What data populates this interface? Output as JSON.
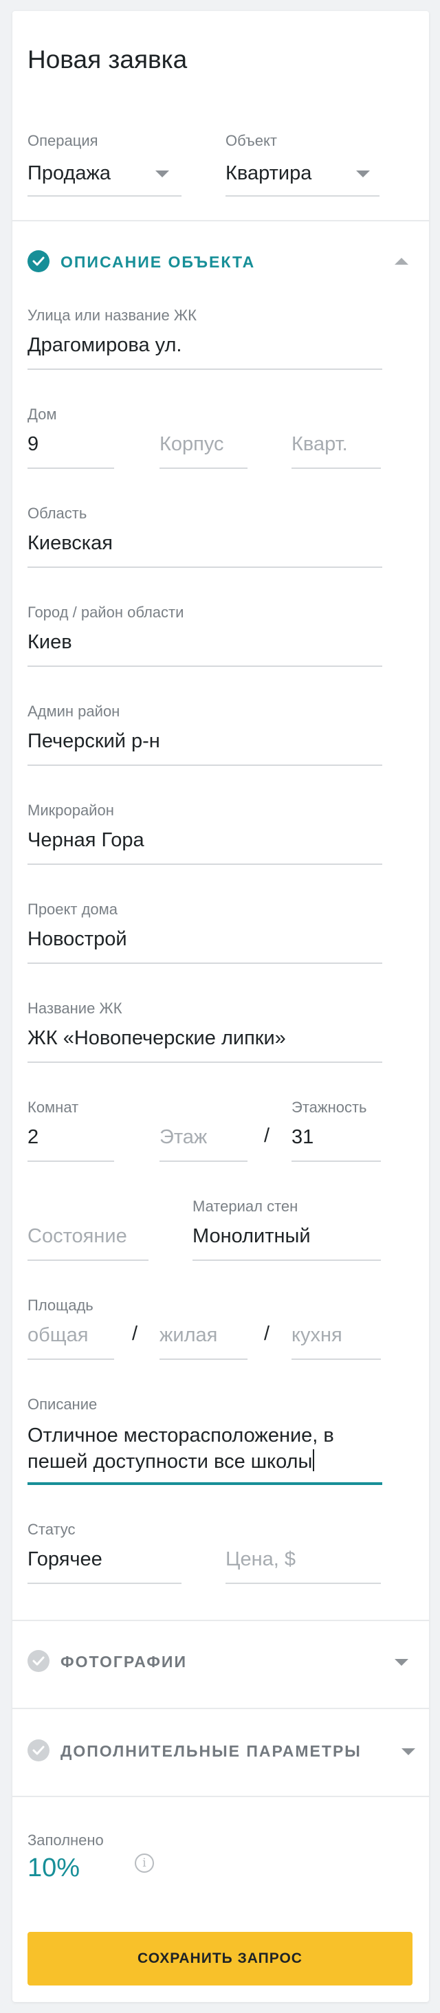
{
  "form": {
    "title": "Новая заявка",
    "operation": {
      "label": "Операция",
      "value": "Продажа"
    },
    "object": {
      "label": "Объект",
      "value": "Квартира"
    }
  },
  "sections": {
    "description": {
      "title": "ОПИСАНИЕ ОБЪЕКТА",
      "expanded": true
    },
    "photos": {
      "title": "ФОТОГРАФИИ",
      "expanded": false
    },
    "extra": {
      "title": "ДОПОЛНИТЕЛЬНЫЕ ПАРАМЕТРЫ",
      "expanded": false
    }
  },
  "fields": {
    "street": {
      "label": "Улица или название ЖК",
      "value": "Драгомирова ул."
    },
    "house": {
      "label": "Дом",
      "value": "9"
    },
    "building": {
      "placeholder": "Корпус"
    },
    "apartment": {
      "placeholder": "Кварт."
    },
    "region": {
      "label": "Область",
      "value": "Киевская"
    },
    "city": {
      "label": "Город / район области",
      "value": "Киев"
    },
    "admin_district": {
      "label": "Админ район",
      "value": "Печерский р-н"
    },
    "microdistrict": {
      "label": "Микрорайон",
      "value": "Черная Гора"
    },
    "house_project": {
      "label": "Проект дома",
      "value": "Новострой"
    },
    "complex_name": {
      "label": "Название ЖК",
      "value": "ЖК «Новопечерские липки»"
    },
    "rooms": {
      "label": "Комнат",
      "value": "2"
    },
    "floor": {
      "placeholder": "Этаж"
    },
    "floors_total": {
      "label": "Этажность",
      "value": "31"
    },
    "condition": {
      "placeholder": "Состояние"
    },
    "wall_material": {
      "label": "Материал  стен",
      "value": "Монолитный"
    },
    "area": {
      "label": "Площадь",
      "total_placeholder": "общая",
      "living_placeholder": "жилая",
      "kitchen_placeholder": "кухня"
    },
    "description": {
      "label": "Описание",
      "line1": "Отличное месторасположение, в",
      "line2": "пешей доступности все школы"
    },
    "status": {
      "label": "Статус",
      "value": "Горячее"
    },
    "price": {
      "placeholder": "Цена, $"
    }
  },
  "separator": "/",
  "progress": {
    "label": "Заполнено",
    "value": "10%",
    "percent": 10
  },
  "save_button": {
    "label": "СОХРАНИТЬ ЗАПРОС"
  },
  "colors": {
    "accent": "#178f98",
    "button": "#f8c12a",
    "background": "#f0f2f4"
  }
}
